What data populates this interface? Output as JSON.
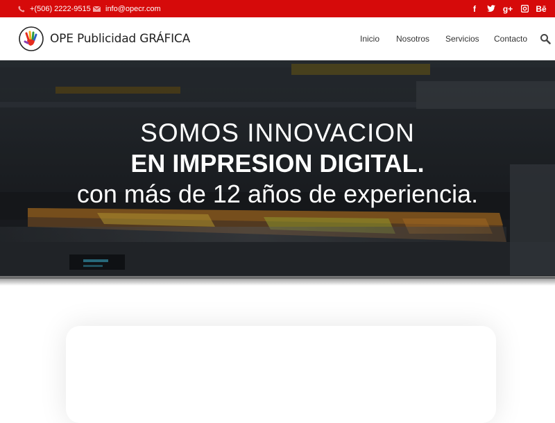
{
  "topbar": {
    "phone": "+(506) 2222-9515",
    "email": "info@opecr.com",
    "social": [
      "f",
      "t",
      "g+",
      "ig",
      "Bē"
    ]
  },
  "header": {
    "brand": "OPE Publicidad GRÁFICA",
    "nav": {
      "inicio": "Inicio",
      "nosotros": "Nosotros",
      "servicios": "Servicios",
      "contacto": "Contacto"
    }
  },
  "hero": {
    "line1": "SOMOS INNOVACION",
    "line2": "EN IMPRESION DIGITAL.",
    "line3": "con más de 12 años de experiencia."
  },
  "colors": {
    "brand_red": "#d60a0a",
    "text_dark": "#222222"
  }
}
